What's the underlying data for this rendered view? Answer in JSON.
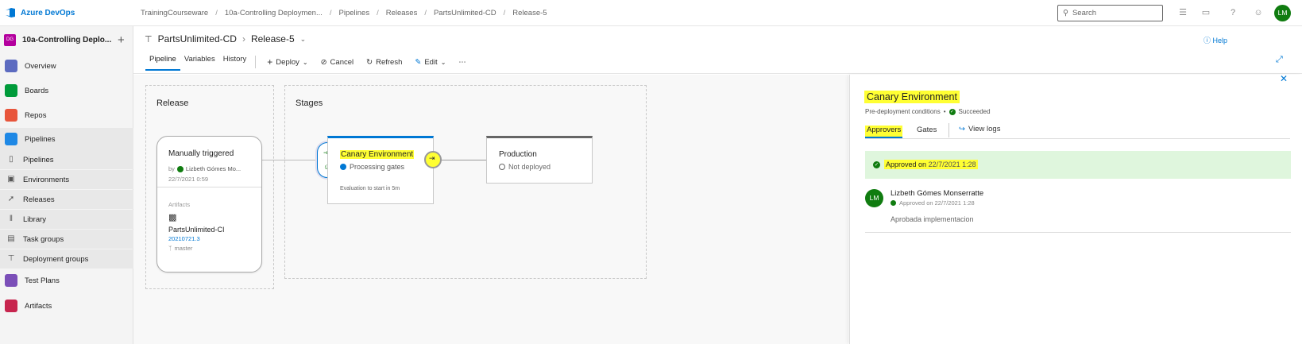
{
  "topbar": {
    "brand": "Azure DevOps",
    "breadcrumbs": [
      "TrainingCourseware",
      "10a-Controlling Deploymen...",
      "Pipelines",
      "Releases",
      "PartsUnlimited-CD",
      "Release-5"
    ],
    "search_placeholder": "Search",
    "avatar_initials": "LM"
  },
  "sidebar": {
    "project_badge": "DG",
    "project_name": "10a-Controlling Deplo...",
    "items": [
      {
        "label": "Overview",
        "icon": "overview-icon",
        "color": "#5c6bc0"
      },
      {
        "label": "Boards",
        "icon": "boards-icon",
        "color": "#009b3a"
      },
      {
        "label": "Repos",
        "icon": "repos-icon",
        "color": "#e8553b"
      },
      {
        "label": "Pipelines",
        "icon": "pipelines-icon",
        "color": "#1e88e5"
      },
      {
        "label": "Pipelines",
        "icon": "pipeline-sub-icon"
      },
      {
        "label": "Environments",
        "icon": "environments-icon"
      },
      {
        "label": "Releases",
        "icon": "releases-icon"
      },
      {
        "label": "Library",
        "icon": "library-icon"
      },
      {
        "label": "Task groups",
        "icon": "task-groups-icon"
      },
      {
        "label": "Deployment groups",
        "icon": "deployment-groups-icon"
      },
      {
        "label": "Test Plans",
        "icon": "test-plans-icon",
        "color": "#7b4fb8"
      },
      {
        "label": "Artifacts",
        "icon": "artifacts-icon",
        "color": "#c7254e"
      }
    ]
  },
  "header": {
    "pipeline_name": "PartsUnlimited-CD",
    "release_name": "Release-5",
    "tabs": [
      "Pipeline",
      "Variables",
      "History"
    ],
    "actions": {
      "deploy": "Deploy",
      "cancel": "Cancel",
      "refresh": "Refresh",
      "edit": "Edit"
    },
    "help": "Help"
  },
  "canvas": {
    "release_section_title": "Release",
    "stages_section_title": "Stages",
    "release_card": {
      "trigger": "Manually triggered",
      "by_prefix": "by",
      "by_user": "Lizbeth Gómes Mo...",
      "date": "22/7/2021 0:59",
      "artifacts_label": "Artifacts",
      "artifact_name": "PartsUnlimited-CI",
      "artifact_version": "20210721.3",
      "branch": "master"
    },
    "stage_canary": {
      "name": "Canary Environment",
      "status": "Processing gates",
      "note": "Evaluation to start in 5m",
      "accent": "#0078d4"
    },
    "stage_production": {
      "name": "Production",
      "status": "Not deployed"
    }
  },
  "panel": {
    "title": "Canary Environment",
    "conditions_label": "Pre-deployment conditions",
    "conditions_status": "Succeeded",
    "tabs": [
      "Approvers",
      "Gates"
    ],
    "view_logs": "View logs",
    "approved_banner_prefix": "Approved on",
    "approved_banner_date": "22/7/2021 1:28",
    "approver": {
      "initials": "LM",
      "name": "Lizbeth Gómes Monserratte",
      "status": "Approved on 22/7/2021 1:28",
      "comment": "Aprobada implementacion"
    },
    "success_color": "#107c10",
    "banner_bg": "#dff6dd"
  }
}
